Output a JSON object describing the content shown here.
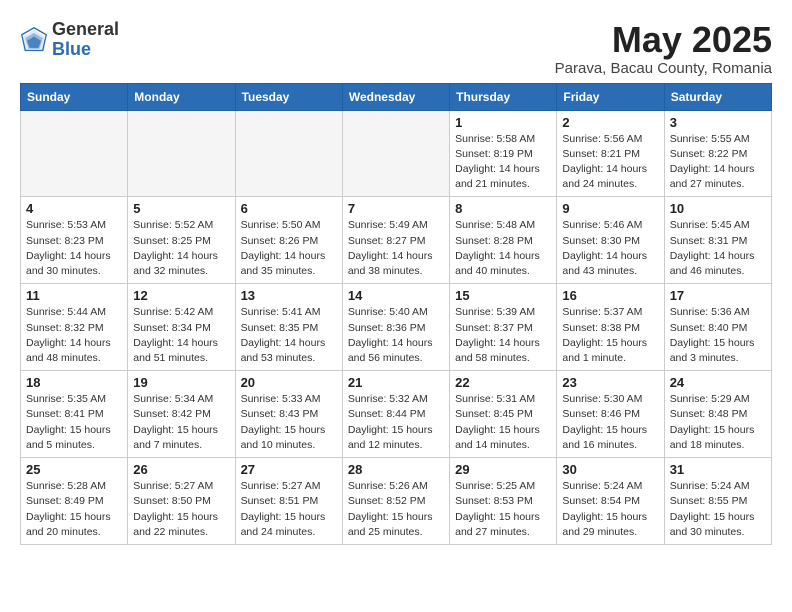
{
  "logo": {
    "general": "General",
    "blue": "Blue"
  },
  "title": "May 2025",
  "subtitle": "Parava, Bacau County, Romania",
  "days_header": [
    "Sunday",
    "Monday",
    "Tuesday",
    "Wednesday",
    "Thursday",
    "Friday",
    "Saturday"
  ],
  "weeks": [
    [
      {
        "day": "",
        "detail": ""
      },
      {
        "day": "",
        "detail": ""
      },
      {
        "day": "",
        "detail": ""
      },
      {
        "day": "",
        "detail": ""
      },
      {
        "day": "1",
        "detail": "Sunrise: 5:58 AM\nSunset: 8:19 PM\nDaylight: 14 hours\nand 21 minutes."
      },
      {
        "day": "2",
        "detail": "Sunrise: 5:56 AM\nSunset: 8:21 PM\nDaylight: 14 hours\nand 24 minutes."
      },
      {
        "day": "3",
        "detail": "Sunrise: 5:55 AM\nSunset: 8:22 PM\nDaylight: 14 hours\nand 27 minutes."
      }
    ],
    [
      {
        "day": "4",
        "detail": "Sunrise: 5:53 AM\nSunset: 8:23 PM\nDaylight: 14 hours\nand 30 minutes."
      },
      {
        "day": "5",
        "detail": "Sunrise: 5:52 AM\nSunset: 8:25 PM\nDaylight: 14 hours\nand 32 minutes."
      },
      {
        "day": "6",
        "detail": "Sunrise: 5:50 AM\nSunset: 8:26 PM\nDaylight: 14 hours\nand 35 minutes."
      },
      {
        "day": "7",
        "detail": "Sunrise: 5:49 AM\nSunset: 8:27 PM\nDaylight: 14 hours\nand 38 minutes."
      },
      {
        "day": "8",
        "detail": "Sunrise: 5:48 AM\nSunset: 8:28 PM\nDaylight: 14 hours\nand 40 minutes."
      },
      {
        "day": "9",
        "detail": "Sunrise: 5:46 AM\nSunset: 8:30 PM\nDaylight: 14 hours\nand 43 minutes."
      },
      {
        "day": "10",
        "detail": "Sunrise: 5:45 AM\nSunset: 8:31 PM\nDaylight: 14 hours\nand 46 minutes."
      }
    ],
    [
      {
        "day": "11",
        "detail": "Sunrise: 5:44 AM\nSunset: 8:32 PM\nDaylight: 14 hours\nand 48 minutes."
      },
      {
        "day": "12",
        "detail": "Sunrise: 5:42 AM\nSunset: 8:34 PM\nDaylight: 14 hours\nand 51 minutes."
      },
      {
        "day": "13",
        "detail": "Sunrise: 5:41 AM\nSunset: 8:35 PM\nDaylight: 14 hours\nand 53 minutes."
      },
      {
        "day": "14",
        "detail": "Sunrise: 5:40 AM\nSunset: 8:36 PM\nDaylight: 14 hours\nand 56 minutes."
      },
      {
        "day": "15",
        "detail": "Sunrise: 5:39 AM\nSunset: 8:37 PM\nDaylight: 14 hours\nand 58 minutes."
      },
      {
        "day": "16",
        "detail": "Sunrise: 5:37 AM\nSunset: 8:38 PM\nDaylight: 15 hours\nand 1 minute."
      },
      {
        "day": "17",
        "detail": "Sunrise: 5:36 AM\nSunset: 8:40 PM\nDaylight: 15 hours\nand 3 minutes."
      }
    ],
    [
      {
        "day": "18",
        "detail": "Sunrise: 5:35 AM\nSunset: 8:41 PM\nDaylight: 15 hours\nand 5 minutes."
      },
      {
        "day": "19",
        "detail": "Sunrise: 5:34 AM\nSunset: 8:42 PM\nDaylight: 15 hours\nand 7 minutes."
      },
      {
        "day": "20",
        "detail": "Sunrise: 5:33 AM\nSunset: 8:43 PM\nDaylight: 15 hours\nand 10 minutes."
      },
      {
        "day": "21",
        "detail": "Sunrise: 5:32 AM\nSunset: 8:44 PM\nDaylight: 15 hours\nand 12 minutes."
      },
      {
        "day": "22",
        "detail": "Sunrise: 5:31 AM\nSunset: 8:45 PM\nDaylight: 15 hours\nand 14 minutes."
      },
      {
        "day": "23",
        "detail": "Sunrise: 5:30 AM\nSunset: 8:46 PM\nDaylight: 15 hours\nand 16 minutes."
      },
      {
        "day": "24",
        "detail": "Sunrise: 5:29 AM\nSunset: 8:48 PM\nDaylight: 15 hours\nand 18 minutes."
      }
    ],
    [
      {
        "day": "25",
        "detail": "Sunrise: 5:28 AM\nSunset: 8:49 PM\nDaylight: 15 hours\nand 20 minutes."
      },
      {
        "day": "26",
        "detail": "Sunrise: 5:27 AM\nSunset: 8:50 PM\nDaylight: 15 hours\nand 22 minutes."
      },
      {
        "day": "27",
        "detail": "Sunrise: 5:27 AM\nSunset: 8:51 PM\nDaylight: 15 hours\nand 24 minutes."
      },
      {
        "day": "28",
        "detail": "Sunrise: 5:26 AM\nSunset: 8:52 PM\nDaylight: 15 hours\nand 25 minutes."
      },
      {
        "day": "29",
        "detail": "Sunrise: 5:25 AM\nSunset: 8:53 PM\nDaylight: 15 hours\nand 27 minutes."
      },
      {
        "day": "30",
        "detail": "Sunrise: 5:24 AM\nSunset: 8:54 PM\nDaylight: 15 hours\nand 29 minutes."
      },
      {
        "day": "31",
        "detail": "Sunrise: 5:24 AM\nSunset: 8:55 PM\nDaylight: 15 hours\nand 30 minutes."
      }
    ]
  ]
}
